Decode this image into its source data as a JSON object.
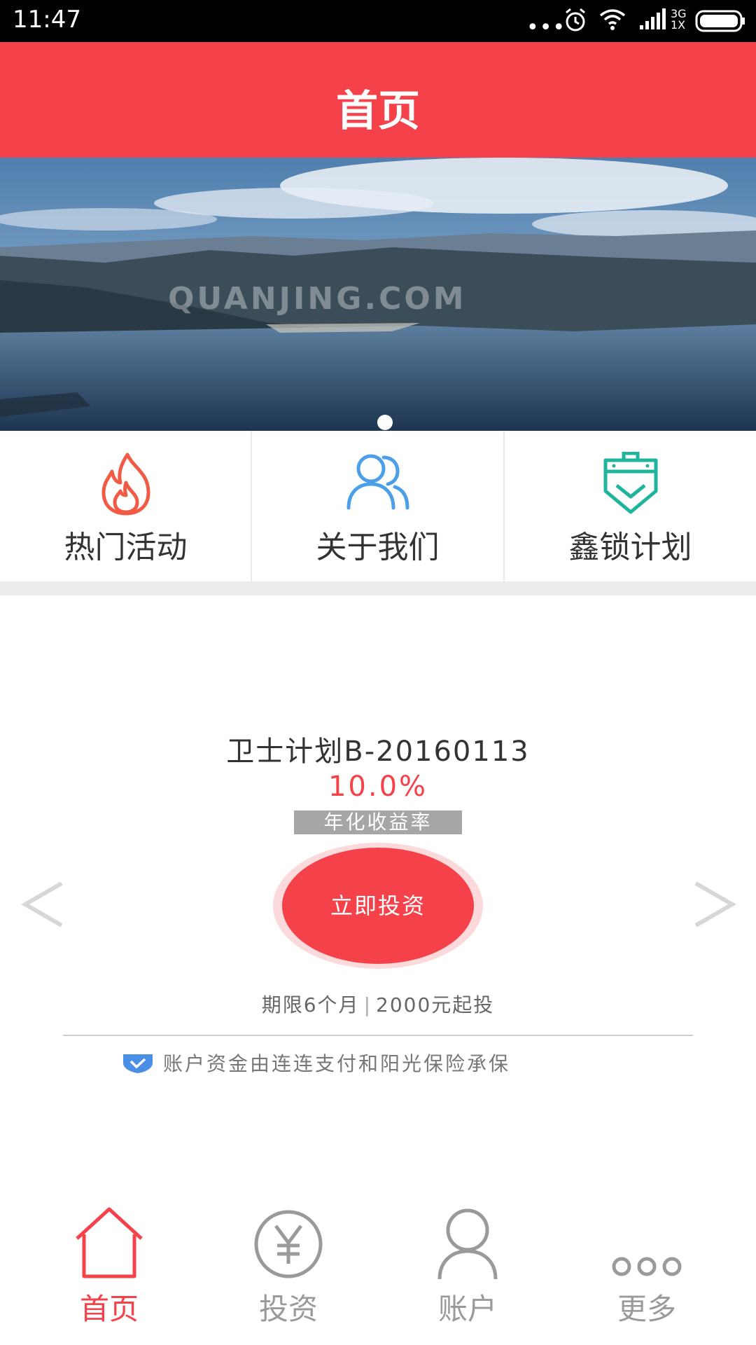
{
  "status_bar": {
    "time": "11:47",
    "network": "3G",
    "network_sub": "1X"
  },
  "header": {
    "title": "首页"
  },
  "banner": {
    "watermark": "QUANJING.COM",
    "slide_count": 1,
    "active_slide": 1
  },
  "quick_menu": [
    {
      "label": "热门活动",
      "icon": "flame-icon",
      "color": "#f15a45"
    },
    {
      "label": "关于我们",
      "icon": "users-icon",
      "color": "#4a9fe8"
    },
    {
      "label": "鑫锁计划",
      "icon": "shield-lock-icon",
      "color": "#1fb59d"
    }
  ],
  "product": {
    "name": "卫士计划B-20160113",
    "rate": "10.0%",
    "rate_label": "年化收益率",
    "invest_button": "立即投资",
    "term": "期限6个月",
    "min_invest": "2000元起投",
    "separator": "|",
    "security_note": "账户资金由连连支付和阳光保险承保"
  },
  "bottom_nav": [
    {
      "label": "首页",
      "icon": "home-icon",
      "active": true
    },
    {
      "label": "投资",
      "icon": "yen-coin-icon",
      "active": false
    },
    {
      "label": "账户",
      "icon": "person-icon",
      "active": false
    },
    {
      "label": "更多",
      "icon": "more-dots-icon",
      "active": false
    }
  ],
  "colors": {
    "brand_red": "#f4414a",
    "gray_text": "#9a9a9a"
  }
}
